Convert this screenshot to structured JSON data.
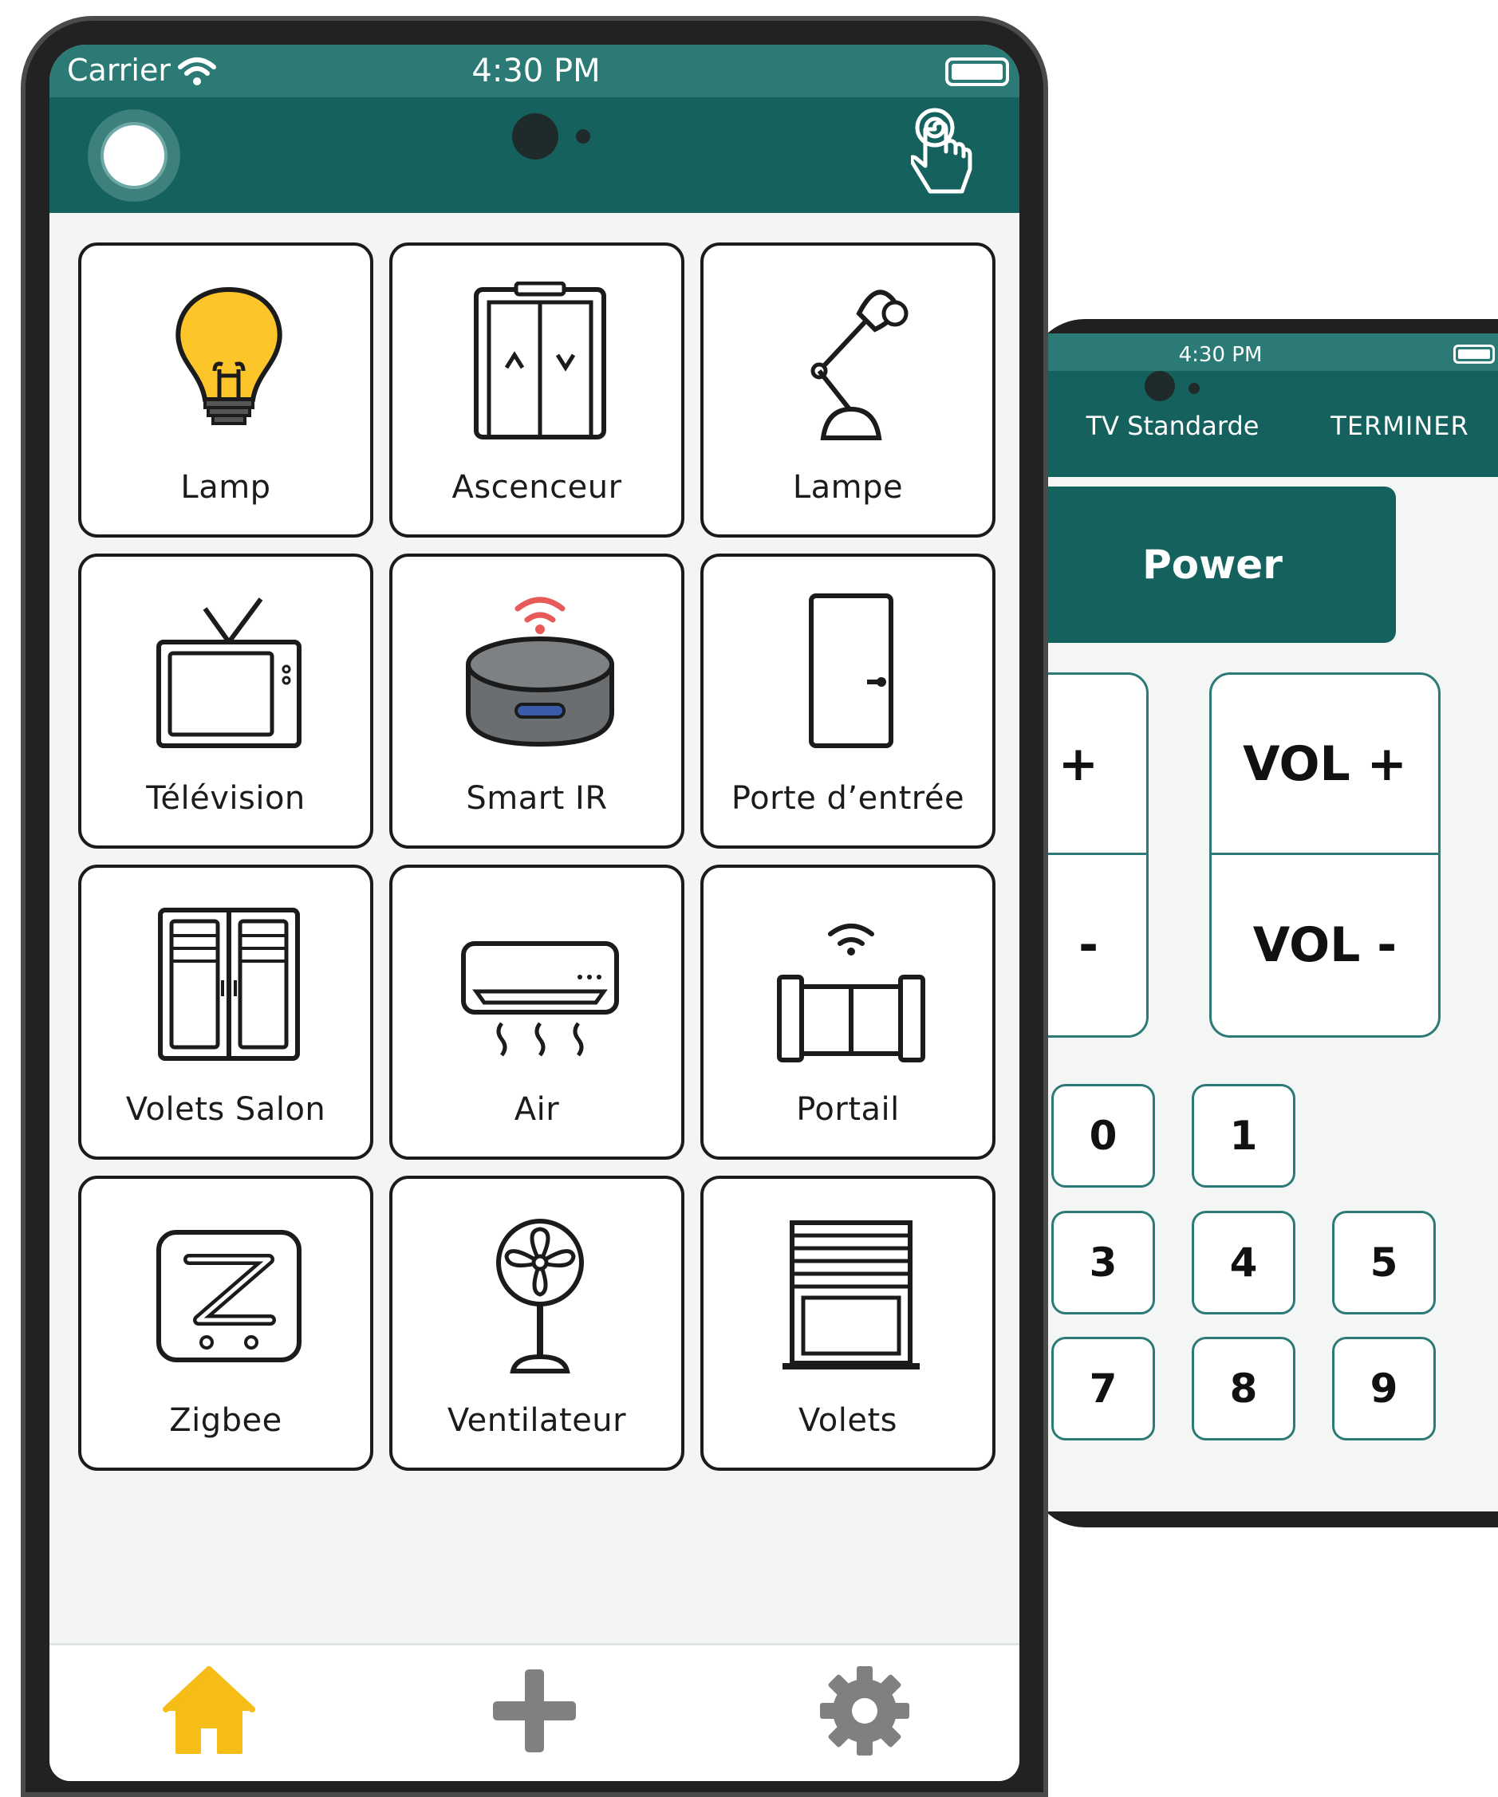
{
  "front_phone": {
    "status_bar": {
      "carrier": "Carrier",
      "time": "4:30 PM"
    },
    "header": {
      "toggle": "power-toggle",
      "action_icon": "touch-gesture-icon"
    },
    "devices": [
      {
        "label": "Lamp",
        "icon": "lightbulb-icon"
      },
      {
        "label": "Ascenceur",
        "icon": "elevator-icon"
      },
      {
        "label": "Lampe",
        "icon": "desk-lamp-icon"
      },
      {
        "label": "Télévision",
        "icon": "television-icon"
      },
      {
        "label": "Smart IR",
        "icon": "smart-speaker-icon"
      },
      {
        "label": "Porte d’entrée",
        "icon": "door-icon"
      },
      {
        "label": "Volets Salon",
        "icon": "wardrobe-shutters-icon"
      },
      {
        "label": "Air",
        "icon": "air-conditioner-icon"
      },
      {
        "label": "Portail",
        "icon": "gate-icon"
      },
      {
        "label": "Zigbee",
        "icon": "zigbee-icon"
      },
      {
        "label": "Ventilateur",
        "icon": "fan-icon"
      },
      {
        "label": "Volets",
        "icon": "window-blinds-icon"
      }
    ],
    "tab_bar": [
      {
        "name": "home",
        "icon": "home-icon",
        "color": "#f6bd16",
        "active": true
      },
      {
        "name": "add",
        "icon": "plus-icon",
        "color": "#808080"
      },
      {
        "name": "settings",
        "icon": "gear-icon",
        "color": "#808080"
      }
    ]
  },
  "back_phone": {
    "status_bar": {
      "time": "4:30 PM"
    },
    "header": {
      "title": "TV Standarde",
      "done": "TERMINER"
    },
    "power_label": "Power",
    "channel": {
      "up": "+",
      "down": "-"
    },
    "volume": {
      "up": "VOL +",
      "down": "VOL -"
    },
    "keypad": [
      "0",
      "1",
      "3",
      "4",
      "5",
      "7",
      "8",
      "9"
    ]
  },
  "colors": {
    "teal_dark": "#15615d",
    "teal_status": "#2b7a75",
    "bulb_yellow": "#fcc52a",
    "wifi_red": "#e85a5a"
  }
}
